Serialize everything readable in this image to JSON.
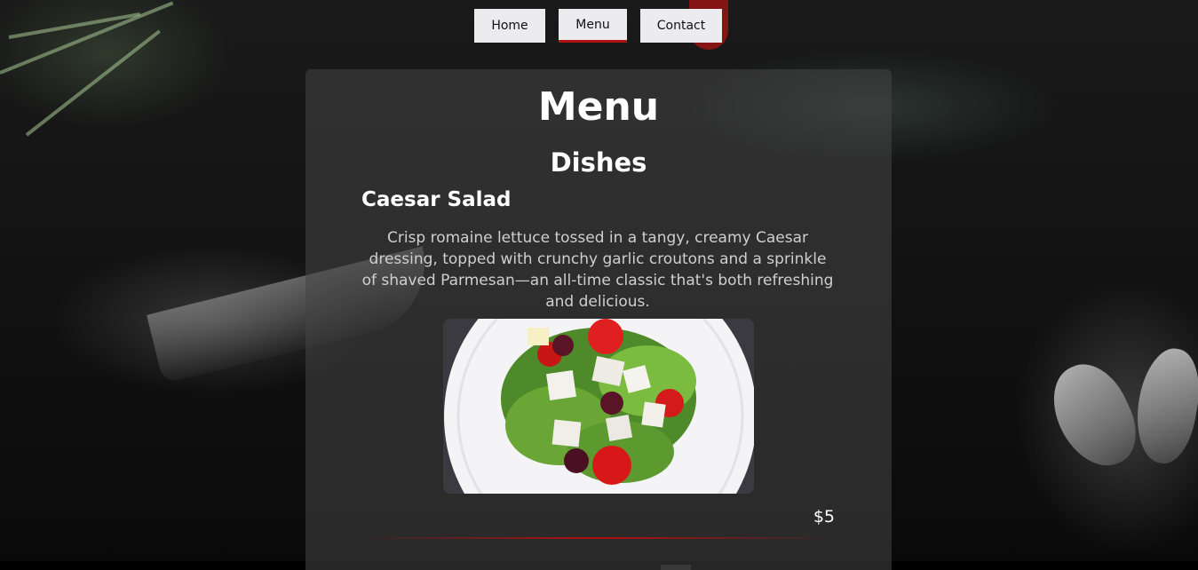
{
  "nav": {
    "items": [
      {
        "label": "Home"
      },
      {
        "label": "Menu",
        "active": true
      },
      {
        "label": "Contact"
      }
    ]
  },
  "page": {
    "title": "Menu",
    "section_title": "Dishes"
  },
  "dish": {
    "name": "Caesar Salad",
    "description": "Crisp romaine lettuce tossed in a tangy, creamy Caesar dressing, topped with crunchy garlic croutons and a sprinkle of shaved Parmesan—an all-time classic that's both refreshing and delicious.",
    "price": "$5",
    "image": "salad-plate"
  },
  "colors": {
    "accent": "#b31313",
    "nav_background": "#ececee",
    "panel_text": "#ffffff"
  }
}
